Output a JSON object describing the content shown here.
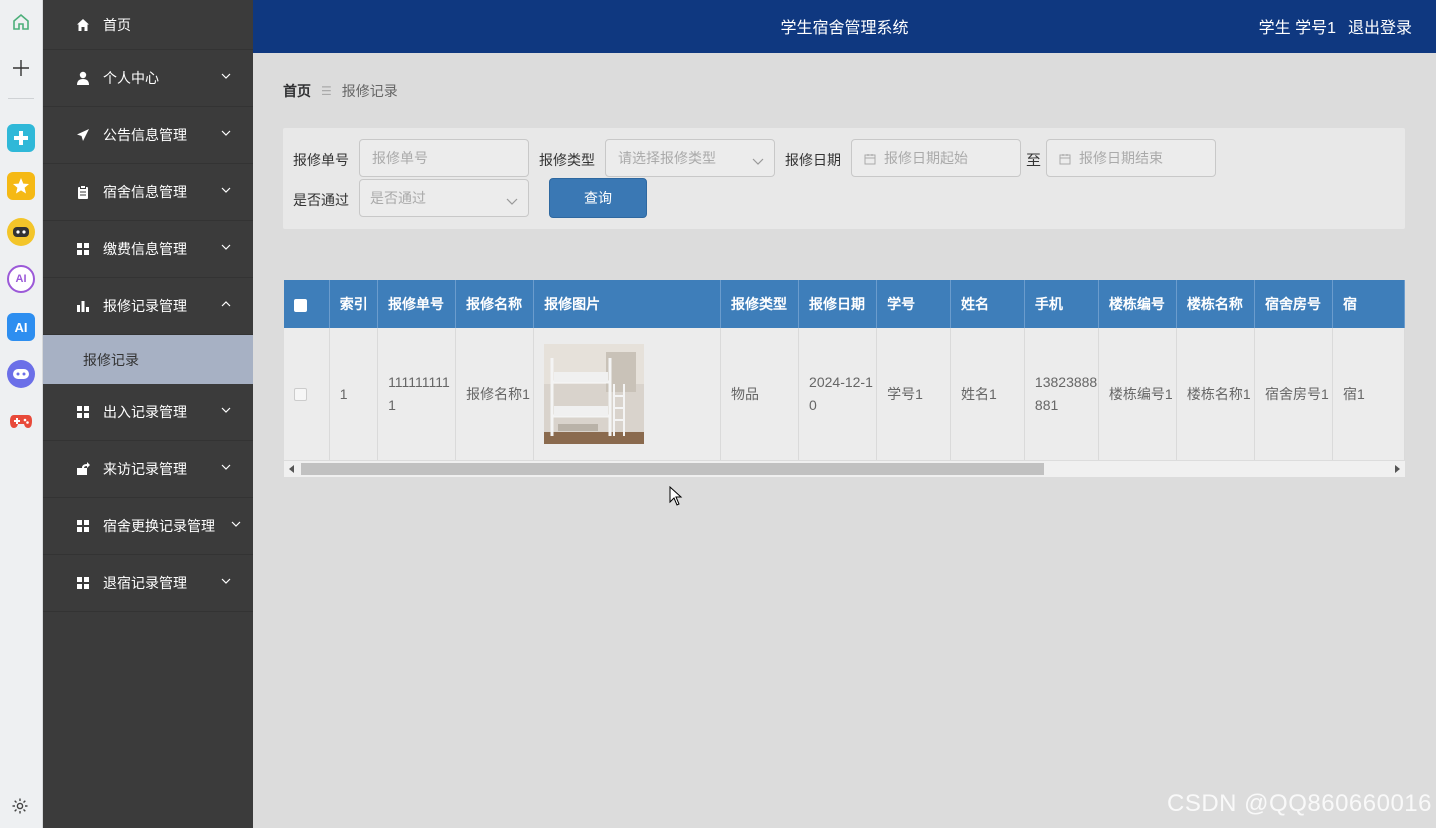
{
  "rail": {
    "icons": [
      "home-icon",
      "plus-icon",
      "app-cross-icon",
      "star-icon",
      "robot-icon",
      "ai-circle-icon",
      "ai-square-icon",
      "bot-face-icon",
      "gamepad-icon"
    ]
  },
  "sidebar": {
    "items": [
      {
        "label": "首页",
        "icon": "home-icon"
      },
      {
        "label": "个人中心",
        "icon": "user-icon"
      },
      {
        "label": "公告信息管理",
        "icon": "send-icon"
      },
      {
        "label": "宿舍信息管理",
        "icon": "clipboard-icon"
      },
      {
        "label": "缴费信息管理",
        "icon": "grid-icon"
      },
      {
        "label": "报修记录管理",
        "icon": "bar-chart-icon"
      },
      {
        "label": "出入记录管理",
        "icon": "grid-icon"
      },
      {
        "label": "来访记录管理",
        "icon": "share-icon"
      },
      {
        "label": "宿舍更换记录管理",
        "icon": "grid-icon"
      },
      {
        "label": "退宿记录管理",
        "icon": "grid-icon"
      }
    ],
    "active_sub": "报修记录"
  },
  "header": {
    "title": "学生宿舍管理系统",
    "role": "学生",
    "user": "学号1",
    "logout": "退出登录"
  },
  "breadcrumb": {
    "home": "首页",
    "current": "报修记录"
  },
  "search": {
    "order_no_label": "报修单号",
    "order_no_placeholder": "报修单号",
    "type_label": "报修类型",
    "type_placeholder": "请选择报修类型",
    "date_label": "报修日期",
    "date_start_placeholder": "报修日期起始",
    "date_to": "至",
    "date_end_placeholder": "报修日期结束",
    "passed_label": "是否通过",
    "passed_placeholder": "是否通过",
    "query_button": "查询"
  },
  "table": {
    "headers": [
      "索引",
      "报修单号",
      "报修名称",
      "报修图片",
      "报修类型",
      "报修日期",
      "学号",
      "姓名",
      "手机",
      "楼栋编号",
      "楼栋名称",
      "宿舍房号",
      "宿"
    ],
    "rows": [
      {
        "index": "1",
        "order_no": "1111111111",
        "name": "报修名称1",
        "type": "物品",
        "date": "2024-12-10",
        "student_no": "学号1",
        "student_name": "姓名1",
        "phone": "13823888881",
        "building_no": "楼栋编号1",
        "building_name": "楼栋名称1",
        "room_no": "宿舍房号1",
        "extra": "宿1"
      }
    ]
  },
  "watermark": "CSDN @QQ860660016",
  "colors": {
    "header_bg": "#0f3880",
    "sidebar_bg": "#3b3b3b",
    "table_header_bg": "#3e7eba",
    "active_sub_bg": "#a7b1c4",
    "button_bg": "#3a78b4"
  }
}
